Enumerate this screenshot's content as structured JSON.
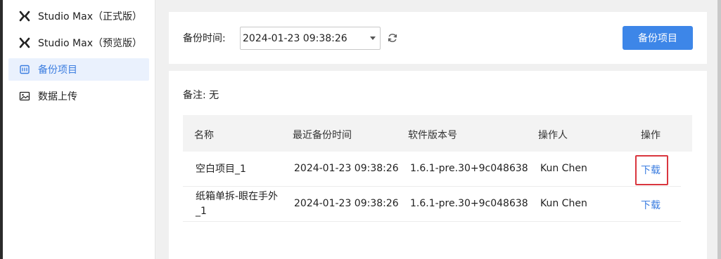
{
  "sidebar": {
    "items": [
      {
        "label": "Studio Max（正式版）",
        "icon": "x-logo-icon"
      },
      {
        "label": "Studio Max（预览版）",
        "icon": "x-logo-icon"
      },
      {
        "label": "备份项目",
        "icon": "backup-icon",
        "active": true
      },
      {
        "label": "数据上传",
        "icon": "image-icon"
      }
    ]
  },
  "toolbar": {
    "time_label": "备份时间:",
    "time_value": "2024-01-23 09:38:26",
    "refresh_icon": "refresh-icon",
    "backup_button": "备份项目"
  },
  "content": {
    "note": "备注: 无",
    "table": {
      "headers": [
        "名称",
        "最近备份时间",
        "软件版本号",
        "操作人",
        "操作"
      ],
      "rows": [
        {
          "name": "空白项目_1",
          "time": "2024-01-23 09:38:26",
          "version": "1.6.1-pre.30+9c048638",
          "operator": "Kun Chen",
          "action": "下载"
        },
        {
          "name": "纸箱单拆-眼在手外_1",
          "time": "2024-01-23 09:38:26",
          "version": "1.6.1-pre.30+9c048638",
          "operator": "Kun Chen",
          "action": "下载"
        }
      ]
    }
  },
  "colors": {
    "accent": "#3d86e8",
    "link": "#3b7de0",
    "highlight": "#d9363e",
    "active_bg": "#eaf1fd"
  }
}
